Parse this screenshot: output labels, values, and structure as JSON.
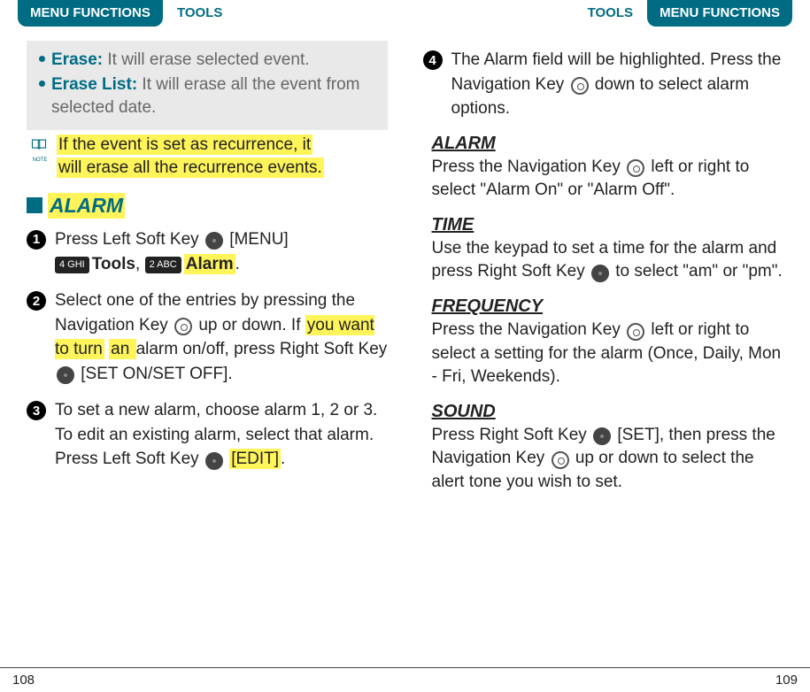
{
  "header": {
    "menu_functions": "MENU FUNCTIONS",
    "tools": "TOOLS"
  },
  "left_page": {
    "gray_box": {
      "erase_label": "Erase:",
      "erase_text": " It will erase selected event.",
      "erase_list_label": "Erase List:",
      "erase_list_text": " It will erase all the event from selected date."
    },
    "note_line1": "If the event is set as recurrence, it",
    "note_line2": "will erase all the recurrence events.",
    "alarm_title": "ALARM",
    "steps": {
      "s1_a": "Press Left Soft Key ",
      "s1_b": " [MENU] ",
      "s1_tools": "Tools",
      "s1_comma": ", ",
      "s1_alarm": "Alarm",
      "s1_end": ".",
      "s2_a": "Select one of the entries by pressing the Navigation Key ",
      "s2_b": " up or down. If ",
      "s2_hl1": "you want to turn",
      "s2_hl2": "an ",
      "s2_c": "alarm on/off, press Right Soft Key ",
      "s2_d": " [SET ON/SET OFF].",
      "s3_a": "To set a new alarm, choose alarm 1, 2 or 3. To edit an existing alarm, select that alarm. Press Left Soft Key ",
      "s3_hl": "[EDIT]",
      "s3_end": "."
    }
  },
  "right_page": {
    "step4_a": "The Alarm field will be highlighted. Press the Navigation Key ",
    "step4_b": " down to select alarm options.",
    "alarm_section": {
      "title": "ALARM",
      "body_a": "Press the Navigation Key ",
      "body_b": " left or right to select \"Alarm On\" or \"Alarm Off\"."
    },
    "time_section": {
      "title": "TIME",
      "body_a": "Use the keypad to set a time for the alarm and press Right Soft Key ",
      "body_b": " to select \"am\" or \"pm\"."
    },
    "freq_section": {
      "title": "FREQUENCY",
      "body_a": "Press the Navigation Key ",
      "body_b": " left or right to select a setting for the alarm (Once, Daily, Mon - Fri, Weekends)."
    },
    "sound_section": {
      "title": "SOUND",
      "body_a": "Press Right Soft Key ",
      "body_b": " [SET], then press the Navigation Key ",
      "body_c": " up or down to select the alert tone you wish to set."
    }
  },
  "footer": {
    "left": "108",
    "right": "109"
  },
  "keys": {
    "four": "4 GHI",
    "two": "2 ABC"
  }
}
